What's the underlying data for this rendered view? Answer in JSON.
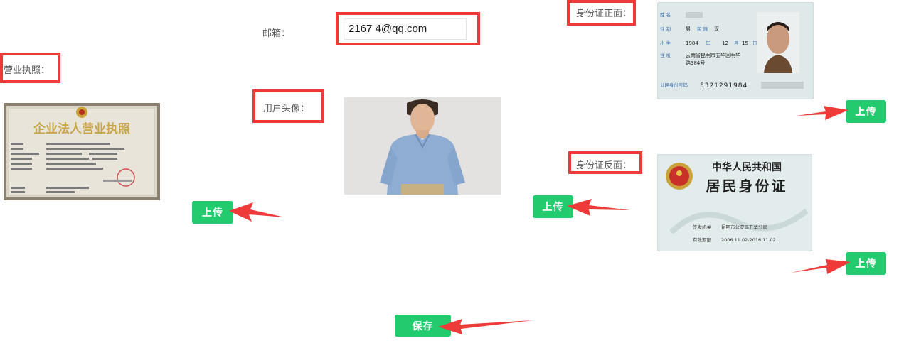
{
  "email": {
    "label": "邮箱：",
    "value": "2167      4@qq.com"
  },
  "business_license": {
    "label": "营业执照：",
    "image_title": "企业法人营业执照",
    "upload_label": "上传"
  },
  "avatar": {
    "label": "用户头像："
  },
  "id_front": {
    "label": "身份证正面：",
    "field_name": "姓 名",
    "field_gender": "性 别",
    "gender": "男",
    "field_ethnicity": "民 族",
    "ethnicity": "汉",
    "field_birth": "出 生",
    "birth_year": "1984",
    "birth_year_unit": "年",
    "birth_month": "12",
    "birth_month_unit": "月",
    "birth_day": "15",
    "birth_day_unit": "日",
    "field_address": "住 址",
    "address_line1": "云南省昆明市五华区明华",
    "address_line2": "路384号",
    "field_id_number": "公民身份号码",
    "id_number": "5321291984",
    "upload_label": "上传"
  },
  "id_back": {
    "label": "身份证反面：",
    "country": "中华人民共和国",
    "card_title": "居民身份证",
    "field_issuer": "签发机关",
    "issuer": "昆明市公安局五华分局",
    "field_valid": "有效期限",
    "valid_period": "2006.11.02-2016.11.02",
    "upload_label": "上传"
  },
  "middle_upload": {
    "label": "上传"
  },
  "save": {
    "label": "保存"
  },
  "colors": {
    "accent_green": "#22cc6e",
    "annotation_red": "#ef3a3a"
  }
}
